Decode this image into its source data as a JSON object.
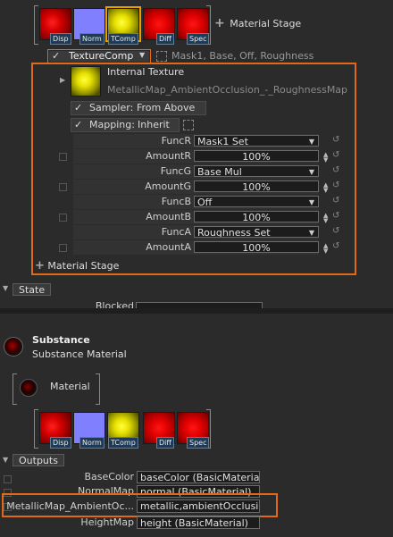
{
  "top_stage": {
    "thumbs": [
      "Disp",
      "Norm",
      "TComp",
      "Diff",
      "Spec"
    ],
    "add_label": "Material Stage"
  },
  "texcomp": {
    "label": "TextureComp",
    "links": "Mask1, Base, Off, Roughness",
    "internal_label": "Internal Texture",
    "texture_name": "MetallicMap_AmbientOcclusion_-_RoughnessMap",
    "sampler": "Sampler:",
    "sampler_value": "From Above",
    "mapping": "Mapping:",
    "mapping_value": "Inherit",
    "params": [
      {
        "label": "FuncR",
        "value": "Mask1 Set",
        "type": "dropdown"
      },
      {
        "label": "AmountR",
        "value": "100%",
        "type": "number"
      },
      {
        "label": "FuncG",
        "value": "Base Mul",
        "type": "dropdown"
      },
      {
        "label": "AmountG",
        "value": "100%",
        "type": "number"
      },
      {
        "label": "FuncB",
        "value": "Off",
        "type": "dropdown"
      },
      {
        "label": "AmountB",
        "value": "100%",
        "type": "number"
      },
      {
        "label": "FuncA",
        "value": "Roughness Set",
        "type": "dropdown"
      },
      {
        "label": "AmountA",
        "value": "100%",
        "type": "number"
      }
    ],
    "material_stage": "Material Stage"
  },
  "state": {
    "label": "State",
    "blocked": "Blocked"
  },
  "substance": {
    "title": "Substance",
    "subtitle": "Substance Material",
    "material": "Material",
    "thumbs": [
      "Disp",
      "Norm",
      "TComp",
      "Diff",
      "Spec"
    ]
  },
  "outputs": {
    "label": "Outputs",
    "rows": [
      {
        "label": "BaseColor",
        "value": "baseColor (BasicMaterial)"
      },
      {
        "label": "NormalMap",
        "value": "normal (BasicMaterial)"
      },
      {
        "label": "MetallicMap_AmbientOc...",
        "value": "metallic,ambientOcclusio..."
      },
      {
        "label": "HeightMap",
        "value": "height (BasicMaterial)"
      }
    ]
  },
  "colors": {
    "accent": "#e06a1a",
    "selection": "#e8a000",
    "label_bg": "#1f3a54"
  }
}
